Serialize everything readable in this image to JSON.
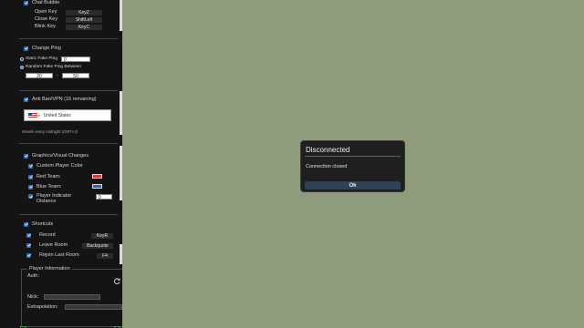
{
  "chat_bubble": {
    "title": "Chat Bubble",
    "open_key_label": "Open Key",
    "open_key_value": "KeyZ",
    "close_key_label": "Close Key",
    "close_key_value": "ShiftLeft",
    "blink_key_label": "Blink Key",
    "blink_key_value": "KeyC"
  },
  "change_ping": {
    "title": "Change Ping",
    "static_label": "Static Fake Ping",
    "static_value": "0",
    "random_label": "Random Fake Ping Between",
    "min_value": "20",
    "separator": "-",
    "max_value": "50"
  },
  "anti_ban": {
    "title": "Anti Ban/VPN (16 remaining)",
    "country": "United States",
    "reset_note": "Resets every midnight (GMT+2)"
  },
  "graphics": {
    "title": "Graphics/Visual Changes",
    "custom_color_label": "Custom Player Color",
    "red_team_label": "Red Team:",
    "red_team_color": "#d43a3a",
    "blue_team_label": "Blue Team:",
    "blue_team_color": "#2f5fc0",
    "indicator_label_line1": "Player Indicator",
    "indicator_label_line2": "Distance",
    "indicator_value": "0"
  },
  "shortcuts": {
    "title": "Shortcuts",
    "record_label": "Record",
    "record_key": "KeyR",
    "leave_label": "Leave Room",
    "leave_key": "Backquote",
    "rejoin_label": "Rejoin Last Room",
    "rejoin_key": "F4"
  },
  "player_info": {
    "title": "Player Information",
    "auth_label": "Auth:",
    "nick_label": "Nick:",
    "nick_value": "",
    "extrapolation_label": "Extrapolation:",
    "extrapolation_value": "",
    "refresh_icon": "refresh-icon"
  },
  "dialog": {
    "title": "Disconnected",
    "message": "Connection closed",
    "ok_label": "Ok"
  },
  "colors": {
    "background": "#8f9c7c",
    "accent": "#2f6fb9",
    "title_underline": "#c0392b"
  }
}
